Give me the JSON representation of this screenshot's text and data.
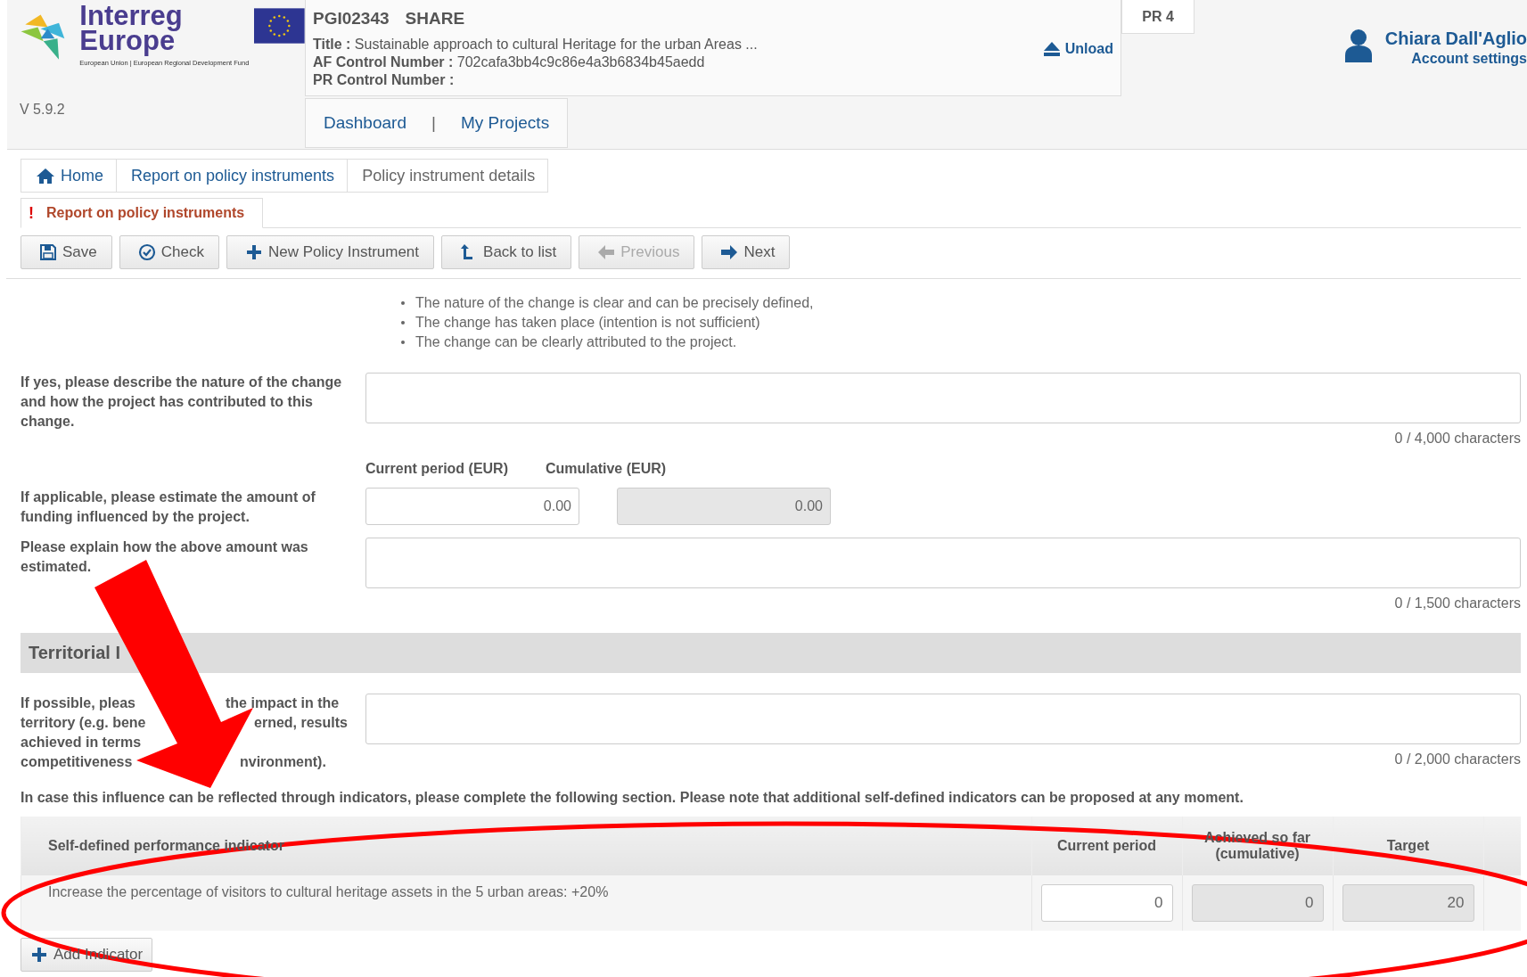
{
  "header": {
    "logo": {
      "line1": "Interreg",
      "line2": "Europe",
      "tagline": "European Union | European Regional Development Fund"
    },
    "version": "V 5.9.2",
    "project": {
      "code": "PGI02343",
      "acronym": "SHARE",
      "fields": [
        {
          "label": "Title :",
          "value": "Sustainable approach to cultural Heritage for the urban Areas ..."
        },
        {
          "label": "AF Control Number :",
          "value": "702cafa3bb4c9c86e4a3b6834b45aedd"
        },
        {
          "label": "PR Control Number :"
        }
      ],
      "unload": "Unload"
    },
    "nav": [
      {
        "label": "Dashboard",
        "kind": "link"
      },
      {
        "label": "|",
        "kind": "separator"
      },
      {
        "label": "My Projects",
        "kind": "link"
      }
    ],
    "pr_tab": "PR 4",
    "user": {
      "name": "Chiara Dall'Aglio",
      "account": "Account settings"
    }
  },
  "breadcrumb": [
    {
      "label": "Home",
      "kind": "home"
    },
    {
      "label": "Report on policy instruments",
      "kind": "link"
    },
    {
      "label": "Policy instrument details",
      "kind": "current"
    }
  ],
  "section_tab": {
    "alert": "!",
    "label": "Report on policy instruments",
    "selected": true
  },
  "toolbar": [
    {
      "label": "Save",
      "disabled": false
    },
    {
      "label": "Check",
      "disabled": false
    },
    {
      "label": "New Policy Instrument",
      "disabled": false
    },
    {
      "label": "Back to list",
      "disabled": false
    },
    {
      "label": "Previous",
      "disabled": true
    },
    {
      "label": "Next",
      "disabled": false
    }
  ],
  "criteria": [
    "The nature of the change is clear and can be precisely defined,",
    "The change has taken place (intention is not sufficient)",
    "The change can be clearly attributed to the project."
  ],
  "describe": {
    "label": "If yes, please describe the nature of the change and how the project has contributed to this change.",
    "counter": "0 / 4,000 characters"
  },
  "funding": {
    "label": "If applicable, please estimate the amount of funding influenced by the project.",
    "columns": [
      {
        "heading": "Current period (EUR)",
        "value": "0.00",
        "disabled": false
      },
      {
        "heading": "Cumulative (EUR)",
        "value": "0.00",
        "disabled": true
      }
    ]
  },
  "explain": {
    "label": "Please explain how the above amount was estimated.",
    "counter": "0 / 1,500 characters"
  },
  "territorial": {
    "heading": "Territorial I",
    "lines": [
      [
        "If possible, pleas",
        "the impact in the"
      ],
      [
        "territory (e.g. bene",
        "erned, results"
      ],
      [
        "achieved in terms"
      ],
      [
        "competitiveness",
        "nvironment)."
      ]
    ],
    "counter": "0 / 2,000 characters"
  },
  "indicators_note": "In case this influence can be reflected through indicators, please complete the following section. Please note that additional self-defined indicators can be proposed at any moment.",
  "table": {
    "columns": [
      "Self-defined performance indicator",
      "Current period",
      "Achieved so far (cumulative)",
      "Target"
    ],
    "rows": [
      {
        "indicator": "Increase the percentage of visitors to cultural heritage assets in the 5 urban areas: +20%",
        "values": [
          {
            "value": "0",
            "disabled": false
          },
          {
            "value": "0",
            "disabled": true
          },
          {
            "value": "20",
            "disabled": true
          }
        ]
      }
    ]
  },
  "add_button": "Add Indicator"
}
